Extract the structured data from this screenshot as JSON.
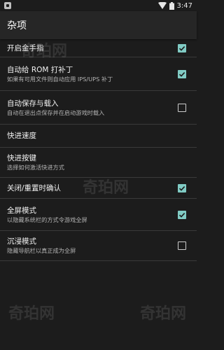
{
  "status_bar": {
    "time": "3:47",
    "icons": [
      "app-icon",
      "wifi-icon",
      "battery-icon"
    ]
  },
  "toolbar": {
    "title": "杂项"
  },
  "settings": [
    {
      "title": "开启金手指",
      "summary": "",
      "checkbox": "checked"
    },
    {
      "title": "自动给 ROM 打补丁",
      "summary": "如果有可用文件则自动应用 IPS/UPS 补丁",
      "checkbox": "checked"
    },
    {
      "title": "自动保存与载入",
      "summary": "自动在退出点保存并在启动游戏时载入",
      "checkbox": "unchecked"
    },
    {
      "title": "快进速度",
      "summary": "",
      "checkbox": "none"
    },
    {
      "title": "快进按键",
      "summary": "选择如何激活快进方式",
      "checkbox": "none"
    },
    {
      "title": "关闭/重置时确认",
      "summary": "",
      "checkbox": "checked"
    },
    {
      "title": "全屏模式",
      "summary": "以隐藏系统栏的方式令游戏全屏",
      "checkbox": "checked"
    },
    {
      "title": "沉浸模式",
      "summary": "隐藏导航栏以真正成为全屏",
      "checkbox": "unchecked"
    }
  ],
  "watermark": "奇珀网",
  "colors": {
    "accent": "#80cbc4",
    "background": "#1c1c1c",
    "toolbar": "#262626",
    "divider": "#3a3a3a"
  }
}
